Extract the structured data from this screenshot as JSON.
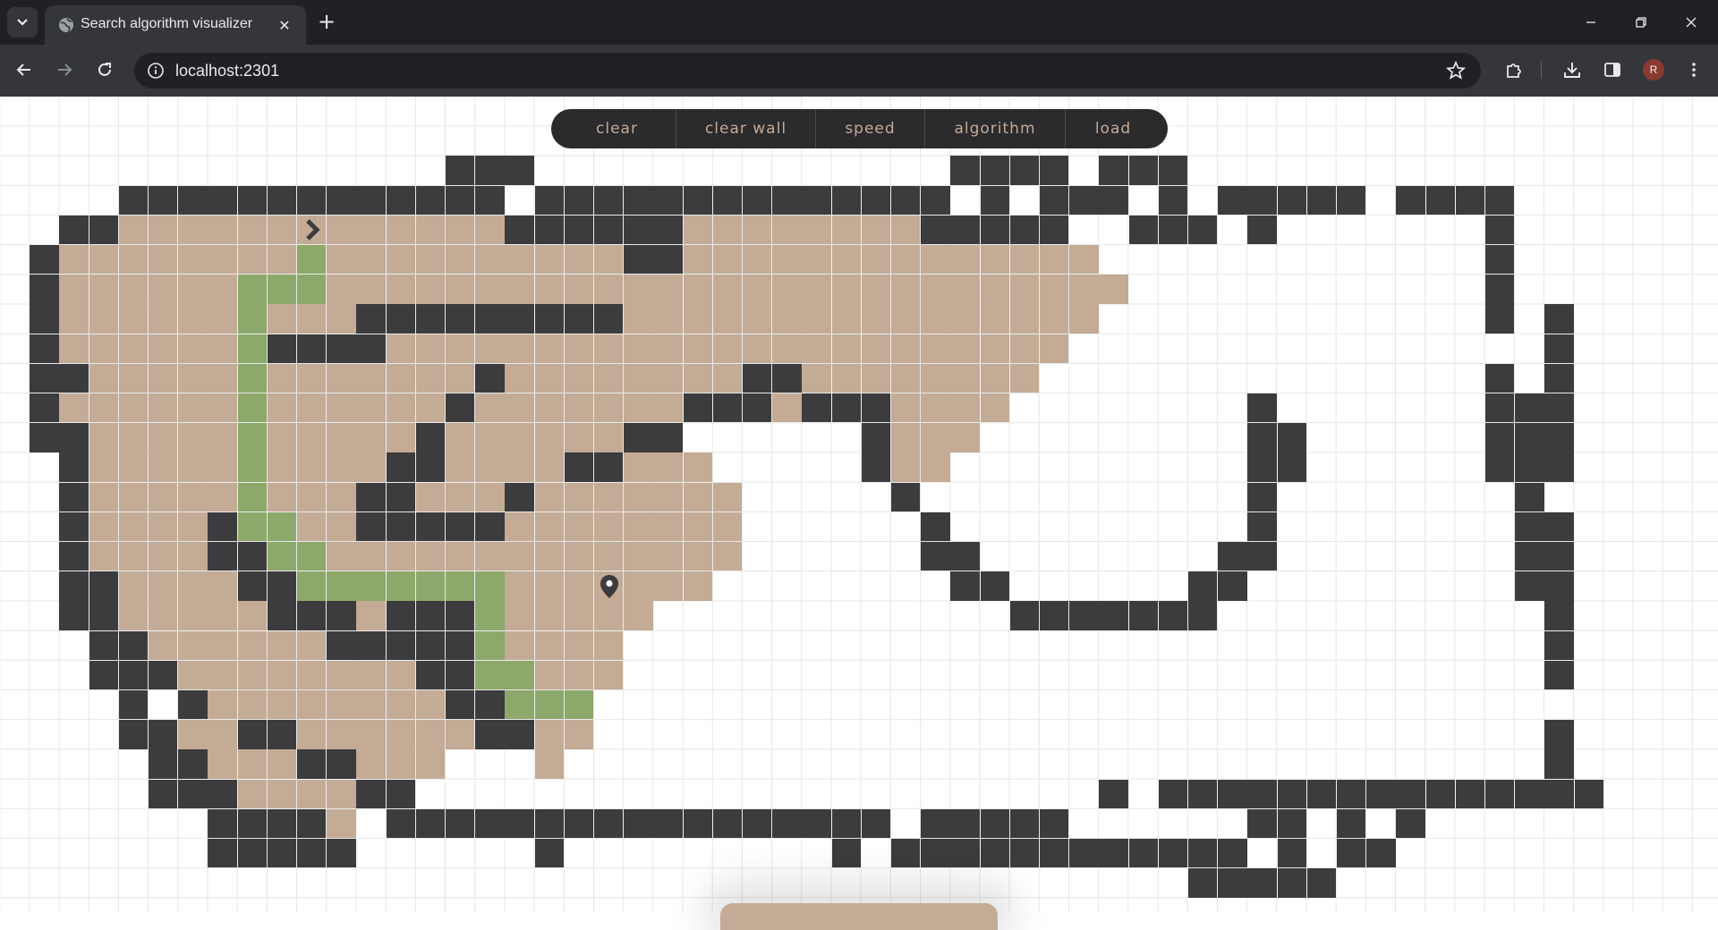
{
  "browser": {
    "tab_title": "Search algorithm visualizer",
    "url": "localhost:2301",
    "profile_initial": "R",
    "icons": [
      "tab-search-icon",
      "globe-icon",
      "close-icon",
      "plus-icon",
      "minimize-icon",
      "restore-icon",
      "close-window-icon",
      "back-icon",
      "forward-icon",
      "reload-icon",
      "info-icon",
      "star-icon",
      "extensions-icon",
      "download-icon",
      "side-panel-icon",
      "more-icon"
    ]
  },
  "toolbar": {
    "buttons": [
      "clear",
      "clear wall",
      "speed",
      "algorithm",
      "load"
    ]
  },
  "grid": {
    "cols": 58,
    "rows": 28,
    "colors": {
      "wall": "#3c3b3d",
      "visited": "#c3ab96",
      "path": "#8da86b",
      "grid_line": "#e6e6e6",
      "background": "#ffffff"
    },
    "start": {
      "row": 4,
      "col": 10,
      "icon": "chevron-right-icon"
    },
    "end": {
      "row": 16,
      "col": 20,
      "icon": "location-pin-icon"
    },
    "walls": [
      [
        2,
        15
      ],
      [
        2,
        16
      ],
      [
        2,
        17
      ],
      [
        2,
        32
      ],
      [
        2,
        33
      ],
      [
        2,
        34
      ],
      [
        2,
        35
      ],
      [
        2,
        37
      ],
      [
        2,
        38
      ],
      [
        2,
        39
      ],
      [
        3,
        4
      ],
      [
        3,
        5
      ],
      [
        3,
        6
      ],
      [
        3,
        7
      ],
      [
        3,
        8
      ],
      [
        3,
        9
      ],
      [
        3,
        10
      ],
      [
        3,
        11
      ],
      [
        3,
        12
      ],
      [
        3,
        13
      ],
      [
        3,
        14
      ],
      [
        3,
        15
      ],
      [
        3,
        16
      ],
      [
        3,
        18
      ],
      [
        3,
        19
      ],
      [
        3,
        20
      ],
      [
        3,
        21
      ],
      [
        3,
        22
      ],
      [
        3,
        23
      ],
      [
        3,
        24
      ],
      [
        3,
        25
      ],
      [
        3,
        26
      ],
      [
        3,
        27
      ],
      [
        3,
        28
      ],
      [
        3,
        29
      ],
      [
        3,
        30
      ],
      [
        3,
        31
      ],
      [
        3,
        33
      ],
      [
        3,
        35
      ],
      [
        3,
        36
      ],
      [
        3,
        37
      ],
      [
        3,
        39
      ],
      [
        3,
        41
      ],
      [
        3,
        42
      ],
      [
        3,
        43
      ],
      [
        3,
        44
      ],
      [
        3,
        45
      ],
      [
        3,
        47
      ],
      [
        3,
        48
      ],
      [
        3,
        49
      ],
      [
        3,
        50
      ],
      [
        4,
        2
      ],
      [
        4,
        3
      ],
      [
        4,
        17
      ],
      [
        4,
        18
      ],
      [
        4,
        19
      ],
      [
        4,
        20
      ],
      [
        4,
        21
      ],
      [
        4,
        22
      ],
      [
        4,
        31
      ],
      [
        4,
        32
      ],
      [
        4,
        33
      ],
      [
        4,
        34
      ],
      [
        4,
        35
      ],
      [
        4,
        38
      ],
      [
        4,
        39
      ],
      [
        4,
        40
      ],
      [
        4,
        42
      ],
      [
        4,
        50
      ],
      [
        5,
        1
      ],
      [
        5,
        21
      ],
      [
        5,
        22
      ],
      [
        5,
        50
      ],
      [
        6,
        1
      ],
      [
        6,
        50
      ],
      [
        7,
        1
      ],
      [
        7,
        12
      ],
      [
        7,
        13
      ],
      [
        7,
        14
      ],
      [
        7,
        15
      ],
      [
        7,
        16
      ],
      [
        7,
        17
      ],
      [
        7,
        18
      ],
      [
        7,
        19
      ],
      [
        7,
        20
      ],
      [
        7,
        50
      ],
      [
        7,
        52
      ],
      [
        8,
        1
      ],
      [
        8,
        9
      ],
      [
        8,
        10
      ],
      [
        8,
        11
      ],
      [
        8,
        12
      ],
      [
        8,
        52
      ],
      [
        9,
        1
      ],
      [
        9,
        2
      ],
      [
        9,
        16
      ],
      [
        9,
        25
      ],
      [
        9,
        26
      ],
      [
        9,
        50
      ],
      [
        9,
        52
      ],
      [
        10,
        1
      ],
      [
        10,
        15
      ],
      [
        10,
        23
      ],
      [
        10,
        24
      ],
      [
        10,
        25
      ],
      [
        10,
        27
      ],
      [
        10,
        28
      ],
      [
        10,
        29
      ],
      [
        10,
        42
      ],
      [
        10,
        50
      ],
      [
        10,
        51
      ],
      [
        10,
        52
      ],
      [
        11,
        1
      ],
      [
        11,
        2
      ],
      [
        11,
        14
      ],
      [
        11,
        21
      ],
      [
        11,
        22
      ],
      [
        11,
        29
      ],
      [
        11,
        42
      ],
      [
        11,
        43
      ],
      [
        11,
        50
      ],
      [
        11,
        51
      ],
      [
        11,
        52
      ],
      [
        12,
        2
      ],
      [
        12,
        13
      ],
      [
        12,
        14
      ],
      [
        12,
        19
      ],
      [
        12,
        20
      ],
      [
        12,
        29
      ],
      [
        12,
        42
      ],
      [
        12,
        43
      ],
      [
        12,
        50
      ],
      [
        12,
        51
      ],
      [
        12,
        52
      ],
      [
        13,
        2
      ],
      [
        13,
        12
      ],
      [
        13,
        13
      ],
      [
        13,
        17
      ],
      [
        13,
        30
      ],
      [
        13,
        42
      ],
      [
        13,
        51
      ],
      [
        14,
        2
      ],
      [
        14,
        7
      ],
      [
        14,
        12
      ],
      [
        14,
        13
      ],
      [
        14,
        14
      ],
      [
        14,
        15
      ],
      [
        14,
        16
      ],
      [
        14,
        31
      ],
      [
        14,
        42
      ],
      [
        14,
        51
      ],
      [
        14,
        52
      ],
      [
        15,
        2
      ],
      [
        15,
        7
      ],
      [
        15,
        8
      ],
      [
        15,
        31
      ],
      [
        15,
        32
      ],
      [
        15,
        41
      ],
      [
        15,
        42
      ],
      [
        15,
        51
      ],
      [
        15,
        52
      ],
      [
        16,
        2
      ],
      [
        16,
        3
      ],
      [
        16,
        8
      ],
      [
        16,
        9
      ],
      [
        16,
        32
      ],
      [
        16,
        33
      ],
      [
        16,
        40
      ],
      [
        16,
        41
      ],
      [
        16,
        51
      ],
      [
        16,
        52
      ],
      [
        17,
        2
      ],
      [
        17,
        3
      ],
      [
        17,
        9
      ],
      [
        17,
        10
      ],
      [
        17,
        11
      ],
      [
        17,
        13
      ],
      [
        17,
        14
      ],
      [
        17,
        15
      ],
      [
        17,
        34
      ],
      [
        17,
        35
      ],
      [
        17,
        36
      ],
      [
        17,
        37
      ],
      [
        17,
        38
      ],
      [
        17,
        39
      ],
      [
        17,
        40
      ],
      [
        17,
        52
      ],
      [
        18,
        3
      ],
      [
        18,
        4
      ],
      [
        18,
        11
      ],
      [
        18,
        12
      ],
      [
        18,
        13
      ],
      [
        18,
        14
      ],
      [
        18,
        15
      ],
      [
        18,
        52
      ],
      [
        19,
        3
      ],
      [
        19,
        4
      ],
      [
        19,
        5
      ],
      [
        19,
        14
      ],
      [
        19,
        15
      ],
      [
        19,
        52
      ],
      [
        20,
        4
      ],
      [
        20,
        6
      ],
      [
        20,
        15
      ],
      [
        20,
        16
      ],
      [
        21,
        4
      ],
      [
        21,
        5
      ],
      [
        21,
        8
      ],
      [
        21,
        9
      ],
      [
        21,
        16
      ],
      [
        21,
        17
      ],
      [
        21,
        52
      ],
      [
        22,
        5
      ],
      [
        22,
        6
      ],
      [
        22,
        10
      ],
      [
        22,
        11
      ],
      [
        22,
        52
      ],
      [
        23,
        5
      ],
      [
        23,
        6
      ],
      [
        23,
        7
      ],
      [
        23,
        12
      ],
      [
        23,
        13
      ],
      [
        23,
        37
      ],
      [
        23,
        39
      ],
      [
        23,
        40
      ],
      [
        23,
        41
      ],
      [
        23,
        42
      ],
      [
        23,
        43
      ],
      [
        23,
        44
      ],
      [
        23,
        45
      ],
      [
        23,
        46
      ],
      [
        23,
        47
      ],
      [
        23,
        48
      ],
      [
        23,
        49
      ],
      [
        23,
        50
      ],
      [
        23,
        51
      ],
      [
        23,
        52
      ],
      [
        23,
        53
      ],
      [
        24,
        7
      ],
      [
        24,
        8
      ],
      [
        24,
        9
      ],
      [
        24,
        10
      ],
      [
        24,
        13
      ],
      [
        24,
        14
      ],
      [
        24,
        15
      ],
      [
        24,
        16
      ],
      [
        24,
        17
      ],
      [
        24,
        18
      ],
      [
        24,
        19
      ],
      [
        24,
        20
      ],
      [
        24,
        21
      ],
      [
        24,
        22
      ],
      [
        24,
        23
      ],
      [
        24,
        24
      ],
      [
        24,
        25
      ],
      [
        24,
        26
      ],
      [
        24,
        27
      ],
      [
        24,
        28
      ],
      [
        24,
        29
      ],
      [
        24,
        31
      ],
      [
        24,
        32
      ],
      [
        24,
        33
      ],
      [
        24,
        34
      ],
      [
        24,
        35
      ],
      [
        24,
        42
      ],
      [
        24,
        43
      ],
      [
        24,
        45
      ],
      [
        24,
        47
      ],
      [
        25,
        7
      ],
      [
        25,
        8
      ],
      [
        25,
        9
      ],
      [
        25,
        10
      ],
      [
        25,
        11
      ],
      [
        25,
        18
      ],
      [
        25,
        28
      ],
      [
        25,
        30
      ],
      [
        25,
        31
      ],
      [
        25,
        32
      ],
      [
        25,
        33
      ],
      [
        25,
        34
      ],
      [
        25,
        35
      ],
      [
        25,
        36
      ],
      [
        25,
        37
      ],
      [
        25,
        38
      ],
      [
        25,
        39
      ],
      [
        25,
        40
      ],
      [
        25,
        41
      ],
      [
        25,
        43
      ],
      [
        25,
        45
      ],
      [
        25,
        46
      ],
      [
        26,
        40
      ],
      [
        26,
        41
      ],
      [
        26,
        42
      ],
      [
        26,
        43
      ],
      [
        26,
        44
      ]
    ],
    "visited_ranges": [
      [
        4,
        4,
        16
      ],
      [
        4,
        23,
        30
      ],
      [
        5,
        2,
        20
      ],
      [
        5,
        23,
        36
      ],
      [
        6,
        2,
        37
      ],
      [
        7,
        2,
        11
      ],
      [
        7,
        21,
        36
      ],
      [
        8,
        2,
        35
      ],
      [
        9,
        3,
        34
      ],
      [
        10,
        2,
        33
      ],
      [
        11,
        3,
        22
      ],
      [
        11,
        30,
        32
      ],
      [
        12,
        3,
        23
      ],
      [
        12,
        30,
        31
      ],
      [
        13,
        3,
        24
      ],
      [
        14,
        3,
        24
      ],
      [
        15,
        3,
        24
      ],
      [
        16,
        4,
        23
      ],
      [
        17,
        4,
        21
      ],
      [
        18,
        5,
        20
      ],
      [
        19,
        6,
        20
      ],
      [
        20,
        7,
        14
      ],
      [
        21,
        6,
        19
      ],
      [
        22,
        7,
        14
      ],
      [
        22,
        18,
        18
      ],
      [
        23,
        8,
        11
      ],
      [
        24,
        11,
        11
      ]
    ],
    "path": [
      [
        5,
        10
      ],
      [
        6,
        8
      ],
      [
        6,
        9
      ],
      [
        6,
        10
      ],
      [
        7,
        8
      ],
      [
        8,
        8
      ],
      [
        9,
        8
      ],
      [
        10,
        8
      ],
      [
        11,
        8
      ],
      [
        12,
        8
      ],
      [
        13,
        8
      ],
      [
        14,
        8
      ],
      [
        14,
        9
      ],
      [
        15,
        9
      ],
      [
        15,
        10
      ],
      [
        16,
        10
      ],
      [
        16,
        11
      ],
      [
        16,
        12
      ],
      [
        16,
        13
      ],
      [
        16,
        14
      ],
      [
        16,
        15
      ],
      [
        16,
        16
      ],
      [
        17,
        16
      ],
      [
        18,
        16
      ],
      [
        19,
        16
      ],
      [
        19,
        17
      ],
      [
        20,
        17
      ],
      [
        20,
        18
      ],
      [
        20,
        19
      ]
    ]
  }
}
